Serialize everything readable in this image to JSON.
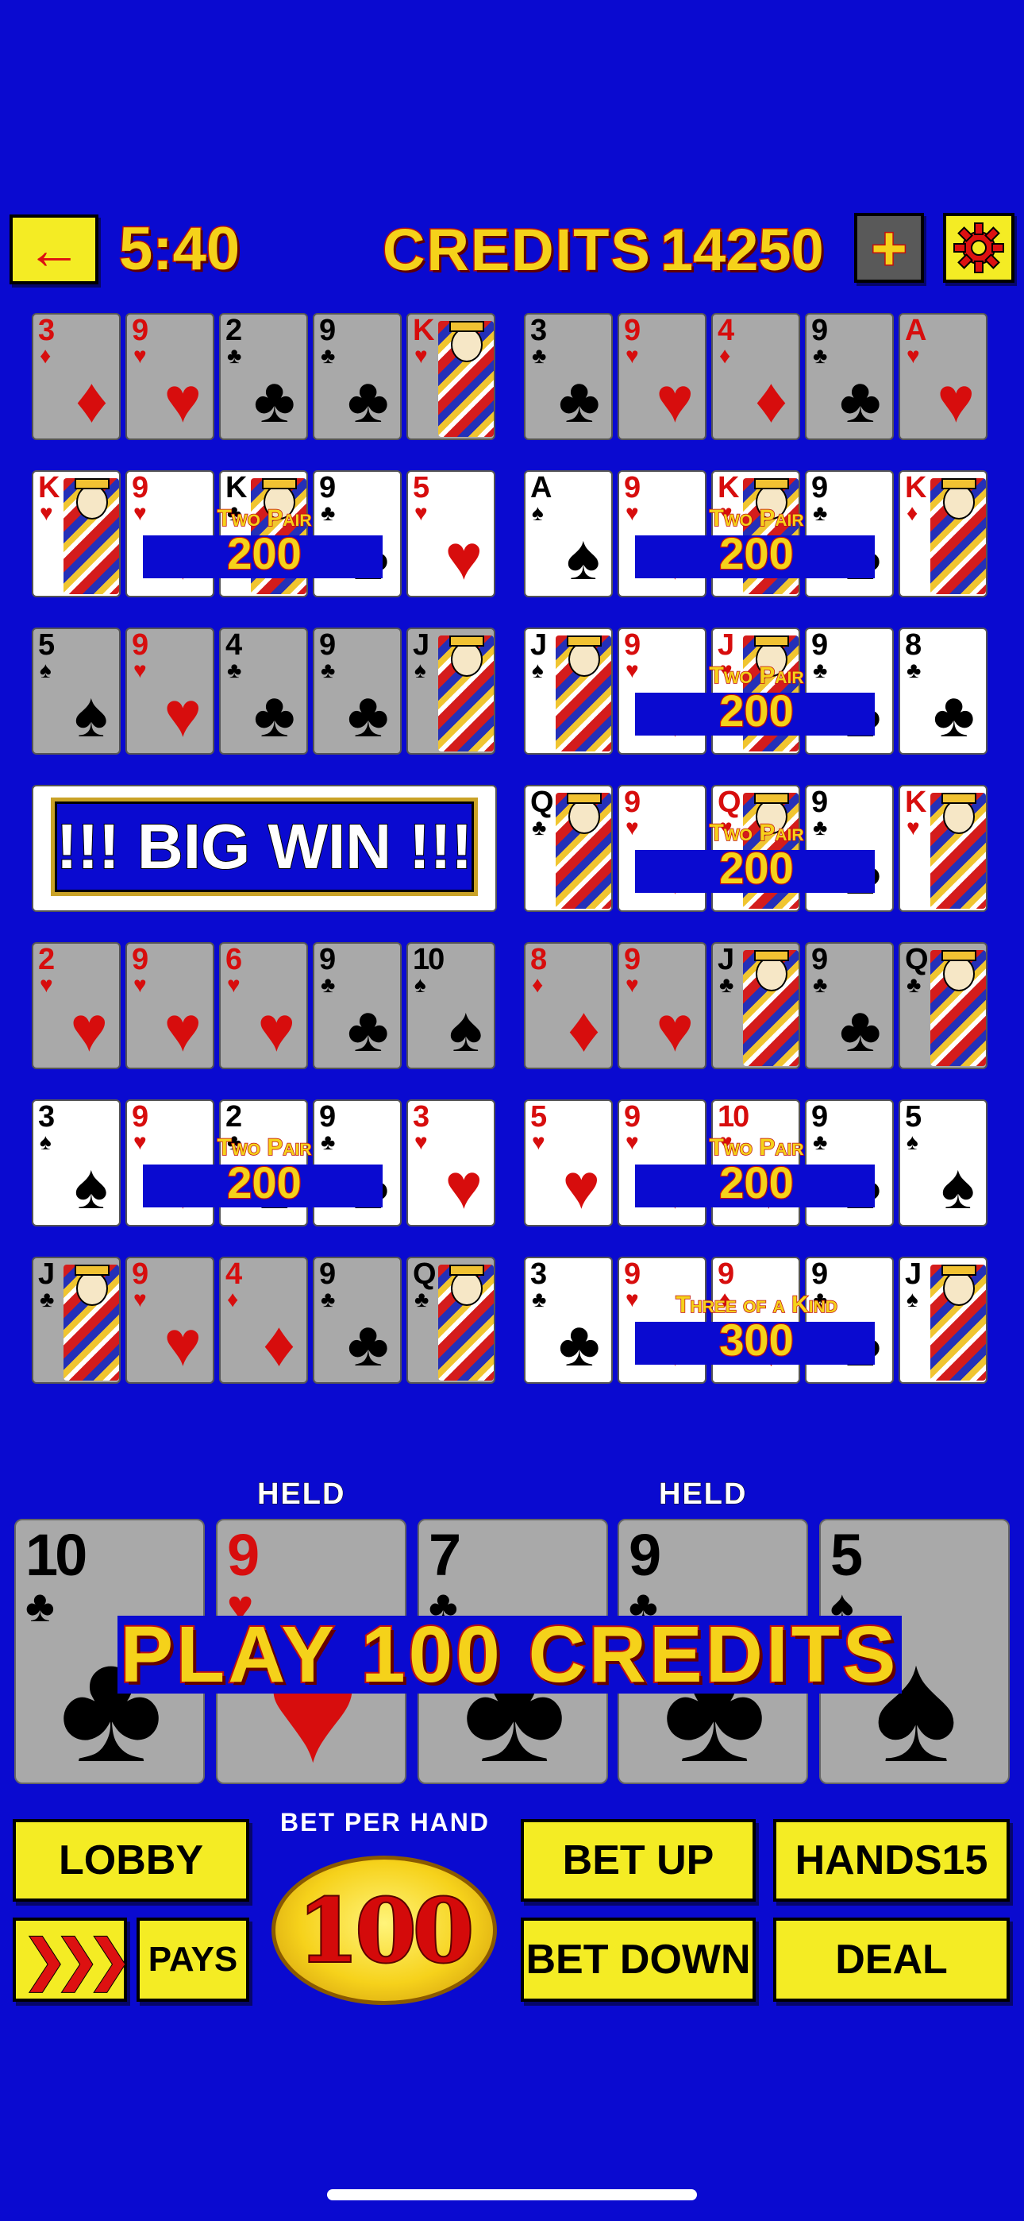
{
  "topbar": {
    "back_glyph": "←",
    "timer": "5:40",
    "credits_label": "CREDITS",
    "credits_value": "14250",
    "plus_glyph": "+"
  },
  "hands": [
    {
      "cards": [
        [
          "3",
          "♦",
          "gray"
        ],
        [
          "9",
          "♥",
          "gray"
        ],
        [
          "2",
          "♣",
          "gray"
        ],
        [
          "9",
          "♣",
          "gray"
        ],
        [
          "K",
          "♥",
          "gray"
        ]
      ],
      "win_name": "",
      "win_amount": ""
    },
    {
      "cards": [
        [
          "3",
          "♣",
          "gray"
        ],
        [
          "9",
          "♥",
          "gray"
        ],
        [
          "4",
          "♦",
          "gray"
        ],
        [
          "9",
          "♣",
          "gray"
        ],
        [
          "A",
          "♥",
          "gray"
        ]
      ],
      "win_name": "",
      "win_amount": ""
    },
    {
      "cards": [
        [
          "K",
          "♥",
          "white"
        ],
        [
          "9",
          "♥",
          "white"
        ],
        [
          "K",
          "♣",
          "white"
        ],
        [
          "9",
          "♣",
          "white"
        ],
        [
          "5",
          "♥",
          "white"
        ]
      ],
      "win_name": "Two Pair",
      "win_amount": "200"
    },
    {
      "cards": [
        [
          "A",
          "♠",
          "white"
        ],
        [
          "9",
          "♥",
          "white"
        ],
        [
          "K",
          "♥",
          "white"
        ],
        [
          "9",
          "♣",
          "white"
        ],
        [
          "K",
          "♦",
          "white"
        ]
      ],
      "win_name": "Two Pair",
      "win_amount": "200"
    },
    {
      "cards": [
        [
          "5",
          "♠",
          "gray"
        ],
        [
          "9",
          "♥",
          "gray"
        ],
        [
          "4",
          "♣",
          "gray"
        ],
        [
          "9",
          "♣",
          "gray"
        ],
        [
          "J",
          "♠",
          "gray"
        ]
      ],
      "win_name": "",
      "win_amount": ""
    },
    {
      "cards": [
        [
          "J",
          "♠",
          "white"
        ],
        [
          "9",
          "♥",
          "white"
        ],
        [
          "J",
          "♥",
          "white"
        ],
        [
          "9",
          "♣",
          "white"
        ],
        [
          "8",
          "♣",
          "white"
        ]
      ],
      "win_name": "Two Pair",
      "win_amount": "200"
    },
    {
      "big_win": "!!! BIG WIN !!!"
    },
    {
      "cards": [
        [
          "Q",
          "♣",
          "white"
        ],
        [
          "9",
          "♥",
          "white"
        ],
        [
          "Q",
          "♥",
          "white"
        ],
        [
          "9",
          "♣",
          "white"
        ],
        [
          "K",
          "♥",
          "white"
        ]
      ],
      "win_name": "Two Pair",
      "win_amount": "200"
    },
    {
      "cards": [
        [
          "2",
          "♥",
          "gray"
        ],
        [
          "9",
          "♥",
          "gray"
        ],
        [
          "6",
          "♥",
          "gray"
        ],
        [
          "9",
          "♣",
          "gray"
        ],
        [
          "10",
          "♠",
          "gray"
        ]
      ],
      "win_name": "",
      "win_amount": ""
    },
    {
      "cards": [
        [
          "8",
          "♦",
          "gray"
        ],
        [
          "9",
          "♥",
          "gray"
        ],
        [
          "J",
          "♣",
          "gray"
        ],
        [
          "9",
          "♣",
          "gray"
        ],
        [
          "Q",
          "♣",
          "gray"
        ]
      ],
      "win_name": "",
      "win_amount": ""
    },
    {
      "cards": [
        [
          "3",
          "♠",
          "white"
        ],
        [
          "9",
          "♥",
          "white"
        ],
        [
          "2",
          "♣",
          "white"
        ],
        [
          "9",
          "♣",
          "white"
        ],
        [
          "3",
          "♥",
          "white"
        ]
      ],
      "win_name": "Two Pair",
      "win_amount": "200"
    },
    {
      "cards": [
        [
          "5",
          "♥",
          "white"
        ],
        [
          "9",
          "♥",
          "white"
        ],
        [
          "10",
          "♥",
          "white"
        ],
        [
          "9",
          "♣",
          "white"
        ],
        [
          "5",
          "♠",
          "white"
        ]
      ],
      "win_name": "Two Pair",
      "win_amount": "200"
    },
    {
      "cards": [
        [
          "J",
          "♣",
          "gray"
        ],
        [
          "9",
          "♥",
          "gray"
        ],
        [
          "4",
          "♦",
          "gray"
        ],
        [
          "9",
          "♣",
          "gray"
        ],
        [
          "Q",
          "♣",
          "gray"
        ]
      ],
      "win_name": "",
      "win_amount": ""
    },
    {
      "cards": [
        [
          "3",
          "♣",
          "white"
        ],
        [
          "9",
          "♥",
          "white"
        ],
        [
          "9",
          "♦",
          "white"
        ],
        [
          "9",
          "♣",
          "white"
        ],
        [
          "J",
          "♠",
          "white"
        ]
      ],
      "win_name": "Three of a Kind",
      "win_amount": "300"
    }
  ],
  "main_hand": {
    "held_label": "HELD",
    "cards": [
      {
        "rank": "10",
        "suit": "♣",
        "held": false
      },
      {
        "rank": "9",
        "suit": "♥",
        "held": true
      },
      {
        "rank": "7",
        "suit": "♣",
        "held": false
      },
      {
        "rank": "9",
        "suit": "♣",
        "held": true
      },
      {
        "rank": "5",
        "suit": "♠",
        "held": false
      }
    ],
    "banner": "PLAY 100 CREDITS"
  },
  "controls": {
    "lobby": "LOBBY",
    "speed_glyph": "❯❯❯",
    "pays": "PAYS",
    "bet_per_hand_label": "BET PER HAND",
    "bet_value": "100",
    "bet_up": "BET UP",
    "bet_down": "BET DOWN",
    "hands_label": "HANDS",
    "hands_value": "15",
    "deal": "DEAL"
  },
  "colors": {
    "background": "#0a0ad0",
    "button_yellow": "#f4ec24",
    "text_gold": "#f5d21a",
    "outline_red": "#c01010"
  },
  "icons": {
    "back": "arrow-left-icon",
    "plus": "plus-icon",
    "settings": "gear-icon",
    "speed": "fast-forward-icon"
  }
}
